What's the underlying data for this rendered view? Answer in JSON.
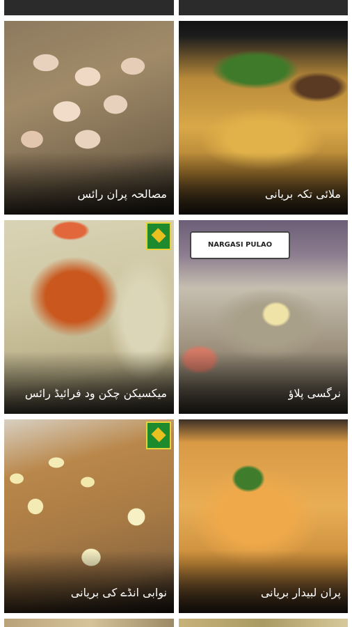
{
  "recipes": [
    {
      "title": "مصالحہ پران رائس"
    },
    {
      "title": "ملائی تکہ بریانی"
    },
    {
      "title": "میکسیکن چکن ود فرائیڈ رائس"
    },
    {
      "title": "نرگسی پلاؤ"
    },
    {
      "title": "نوابی انڈے کی بریانی"
    },
    {
      "title": "پران لبیدار بریانی"
    }
  ],
  "sign_text": "NARGASI PULAO",
  "icons": {
    "channel_logo": "channel-logo-icon"
  }
}
